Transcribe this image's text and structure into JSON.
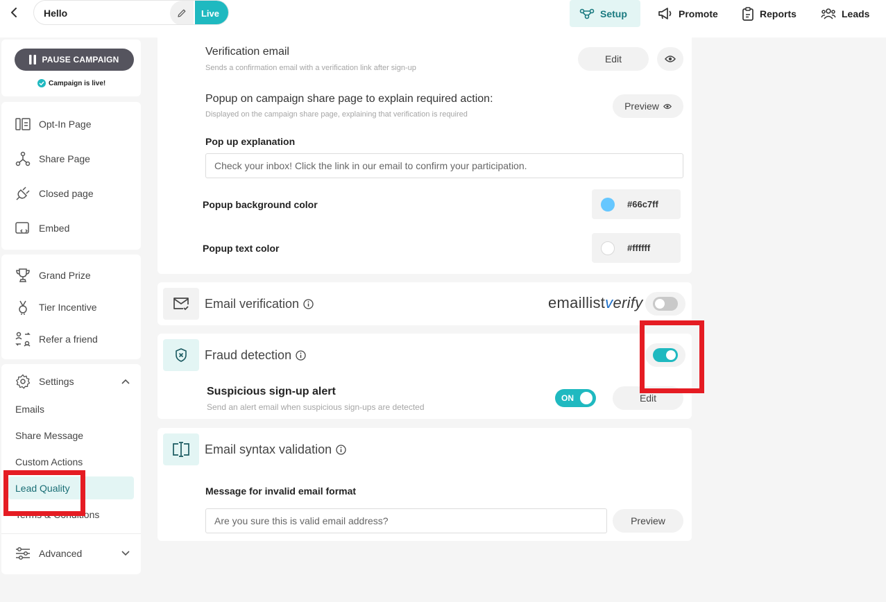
{
  "header": {
    "campaign_name": "Hello",
    "live_label": "Live",
    "nav": [
      {
        "label": "Setup",
        "icon": "setup-icon"
      },
      {
        "label": "Promote",
        "icon": "megaphone-icon"
      },
      {
        "label": "Reports",
        "icon": "clipboard-icon"
      },
      {
        "label": "Leads",
        "icon": "people-icon"
      }
    ]
  },
  "sidebar": {
    "pause_label": "PAUSE CAMPAIGN",
    "status_text": "Campaign is live!",
    "pages": [
      {
        "label": "Opt-In Page",
        "icon": "opt-in-icon"
      },
      {
        "label": "Share Page",
        "icon": "share-icon"
      },
      {
        "label": "Closed page",
        "icon": "plug-icon"
      },
      {
        "label": "Embed",
        "icon": "embed-icon"
      }
    ],
    "prizes": [
      {
        "label": "Grand Prize",
        "icon": "trophy-icon"
      },
      {
        "label": "Tier Incentive",
        "icon": "medal-icon"
      },
      {
        "label": "Refer a friend",
        "icon": "refer-icon"
      }
    ],
    "settings_label": "Settings",
    "settings_items": [
      "Emails",
      "Share Message",
      "Custom Actions",
      "Lead Quality",
      "Terms & Conditions"
    ],
    "advanced_label": "Advanced"
  },
  "main": {
    "verification_email": {
      "title": "Verification email",
      "subtitle": "Sends a confirmation email with a verification link after sign-up",
      "edit_label": "Edit"
    },
    "popup": {
      "title": "Popup on campaign share page to explain required action:",
      "subtitle": "Displayed on the campaign share page, explaining that verification is required",
      "preview_label": "Preview",
      "explanation_label": "Pop up explanation",
      "explanation_value": "Check your inbox! Click the link in our email to confirm your participation.",
      "bg_color_label": "Popup background color",
      "bg_color_value": "#66c7ff",
      "text_color_label": "Popup text color",
      "text_color_value": "#ffffff"
    },
    "email_verification": {
      "title": "Email verification",
      "logo_text_1": "emaillist",
      "logo_text_2": "v",
      "logo_text_3": "erify",
      "enabled": false
    },
    "fraud_detection": {
      "title": "Fraud detection",
      "enabled": true,
      "alert_title": "Suspicious sign-up alert",
      "alert_subtitle": "Send an alert email when suspicious sign-ups are detected",
      "alert_toggle_label": "ON",
      "edit_label": "Edit"
    },
    "syntax_validation": {
      "title": "Email syntax validation",
      "message_label": "Message for invalid email format",
      "message_value": "Are you sure this is valid email address?",
      "preview_label": "Preview"
    }
  },
  "colors": {
    "accent": "#1fb9c0",
    "accent_light": "#e3f5f4",
    "highlight": "#e51c23",
    "pause_button": "#55545e"
  }
}
